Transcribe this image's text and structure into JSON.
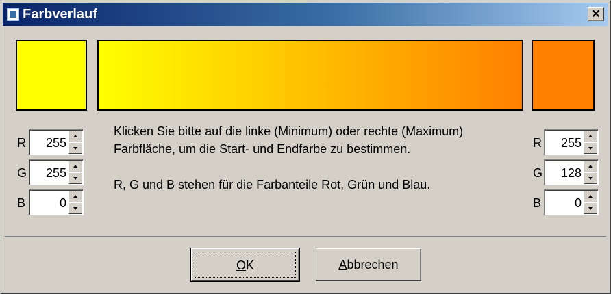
{
  "window": {
    "title": "Farbverlauf",
    "close_icon": "close-icon"
  },
  "colors": {
    "start": "#ffff00",
    "end": "#ff8000"
  },
  "start": {
    "r_label": "R",
    "r_value": "255",
    "g_label": "G",
    "g_value": "255",
    "b_label": "B",
    "b_value": "0"
  },
  "end": {
    "r_label": "R",
    "r_value": "255",
    "g_label": "G",
    "g_value": "128",
    "b_label": "B",
    "b_value": "0"
  },
  "instructions": {
    "line1": "Klicken Sie bitte auf die linke (Minimum) oder rechte (Maximum) Farbfläche, um die Start- und Endfarbe zu bestimmen.",
    "line2": "R, G und B stehen für die Farbanteile Rot, Grün und Blau."
  },
  "buttons": {
    "ok_mnemonic": "O",
    "ok_rest": "K",
    "cancel_mnemonic": "A",
    "cancel_rest": "bbrechen"
  }
}
